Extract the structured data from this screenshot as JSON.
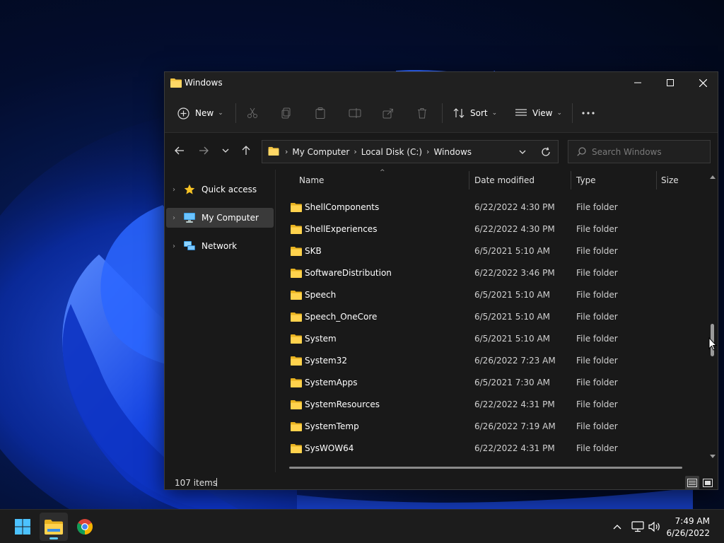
{
  "window": {
    "title": "Windows"
  },
  "toolbar": {
    "new_label": "New",
    "sort_label": "Sort",
    "view_label": "View"
  },
  "address": {
    "crumbs": [
      "My Computer",
      "Local Disk (C:)",
      "Windows"
    ]
  },
  "search": {
    "placeholder": "Search Windows"
  },
  "sidebar": {
    "items": [
      {
        "label": "Quick access"
      },
      {
        "label": "My Computer"
      },
      {
        "label": "Network"
      }
    ]
  },
  "columns": {
    "name": "Name",
    "date": "Date modified",
    "type": "Type",
    "size": "Size"
  },
  "files": [
    {
      "name": "ShellComponents",
      "date": "6/22/2022 4:30 PM",
      "type": "File folder"
    },
    {
      "name": "ShellExperiences",
      "date": "6/22/2022 4:30 PM",
      "type": "File folder"
    },
    {
      "name": "SKB",
      "date": "6/5/2021 5:10 AM",
      "type": "File folder"
    },
    {
      "name": "SoftwareDistribution",
      "date": "6/22/2022 3:46 PM",
      "type": "File folder"
    },
    {
      "name": "Speech",
      "date": "6/5/2021 5:10 AM",
      "type": "File folder"
    },
    {
      "name": "Speech_OneCore",
      "date": "6/5/2021 5:10 AM",
      "type": "File folder"
    },
    {
      "name": "System",
      "date": "6/5/2021 5:10 AM",
      "type": "File folder"
    },
    {
      "name": "System32",
      "date": "6/26/2022 7:23 AM",
      "type": "File folder"
    },
    {
      "name": "SystemApps",
      "date": "6/5/2021 7:30 AM",
      "type": "File folder"
    },
    {
      "name": "SystemResources",
      "date": "6/22/2022 4:31 PM",
      "type": "File folder"
    },
    {
      "name": "SystemTemp",
      "date": "6/26/2022 7:19 AM",
      "type": "File folder"
    },
    {
      "name": "SysWOW64",
      "date": "6/22/2022 4:31 PM",
      "type": "File folder"
    }
  ],
  "status": {
    "items_count": "107 items"
  },
  "taskbar": {
    "time": "7:49 AM",
    "date": "6/26/2022"
  },
  "colors": {
    "accent": "#60cdff",
    "folder": "#f4c542",
    "window_bg": "#191919"
  }
}
